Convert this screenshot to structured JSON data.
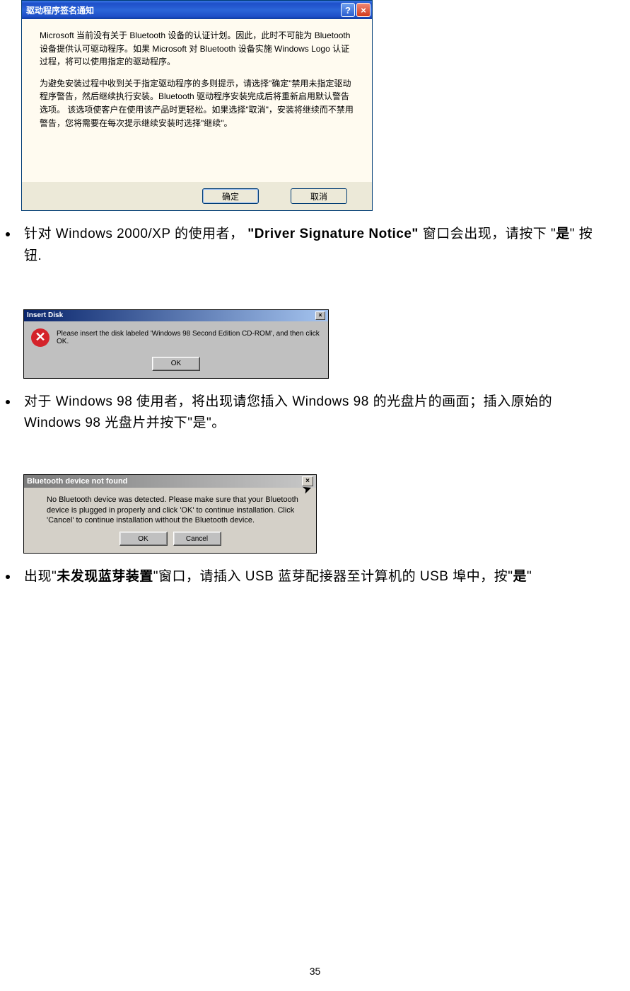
{
  "dialog1": {
    "title": "驱动程序签名通知",
    "help_glyph": "?",
    "close_glyph": "×",
    "paragraph1": "Microsoft 当前没有关于 Bluetooth 设备的认证计划。因此，此时不可能为 Bluetooth 设备提供认可驱动程序。如果 Microsoft 对 Bluetooth 设备实施 Windows Logo 认证过程，将可以使用指定的驱动程序。",
    "paragraph2": "为避免安装过程中收到关于指定驱动程序的多则提示，请选择\"确定\"禁用未指定驱动程序警告，然后继续执行安装。Bluetooth 驱动程序安装完成后将重新启用默认警告选项。 该选项使客户在使用该产品时更轻松。如果选择\"取消\"，安装将继续而不禁用警告，您将需要在每次提示继续安装时选择\"继续\"。",
    "ok_label": "确定",
    "cancel_label": "取消"
  },
  "bullet1": {
    "text_before": "针对 Windows 2000/XP 的使用者，  ",
    "bold": "\"Driver Signature Notice\"",
    "text_after": " 窗口会出现，请按下 \"",
    "bold2": "是",
    "text_after2": "\"  按钮."
  },
  "dialog2": {
    "title": "Insert Disk",
    "close_glyph": "×",
    "error_glyph": "✕",
    "message": "Please insert the disk labeled 'Windows 98 Second Edition CD-ROM', and then click OK.",
    "ok_label": "OK"
  },
  "bullet2": {
    "text": "对于 Windows 98 使用者，将出现请您插入 Windows 98 的光盘片的画面；插入原始的 Windows 98 光盘片并按下\"是\"。"
  },
  "dialog3": {
    "title": "Bluetooth device not found",
    "close_glyph": "×",
    "message": "No Bluetooth device was detected. Please make sure that your Bluetooth device is plugged in properly and click 'OK' to continue installation. Click 'Cancel' to continue installation without the Bluetooth device.",
    "ok_label": "OK",
    "cancel_label": "Cancel"
  },
  "bullet3": {
    "text_before": "出现\"",
    "bold": "未发现蓝芽装置",
    "text_after": "\"窗口，请插入 USB 蓝芽配接器至计算机的 USB 埠中，按\"",
    "bold2": "是",
    "text_after2": "\""
  },
  "page_number": "35"
}
